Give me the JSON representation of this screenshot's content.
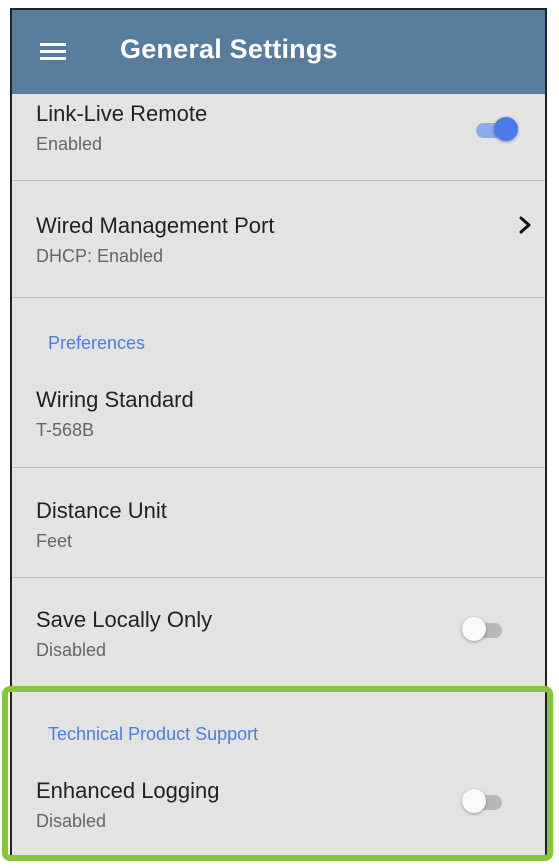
{
  "appbar": {
    "menu_icon": "hamburger-menu-icon",
    "title": "General Settings",
    "background": "#587c9b"
  },
  "settings": {
    "link_live": {
      "title": "Link-Live Remote",
      "status": "Enabled",
      "toggle": true
    },
    "wired_port": {
      "title": "Wired Management Port",
      "status": "DHCP: Enabled",
      "icon": "chevron-right-icon"
    },
    "preferences_header": "Preferences",
    "wiring_standard": {
      "title": "Wiring Standard",
      "status": "T-568B"
    },
    "distance_unit": {
      "title": "Distance Unit",
      "status": "Feet"
    },
    "save_locally": {
      "title": "Save Locally Only",
      "status": "Disabled",
      "toggle": false
    },
    "tech_support_header": "Technical Product Support",
    "enhanced_logging": {
      "title": "Enhanced Logging",
      "status": "Disabled",
      "toggle": false
    }
  },
  "colors": {
    "accent": "#4a7be8",
    "section_header": "#4a7fe0",
    "highlight": "#86c53e"
  }
}
